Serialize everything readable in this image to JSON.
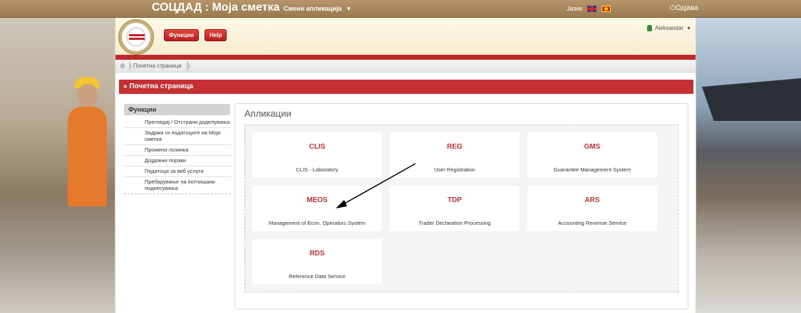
{
  "topbar": {
    "title": "СОЦДАД : Моја сметка",
    "switch_apps": "Смени апликација",
    "language": "Јазик",
    "logout": "Одјава"
  },
  "header": {
    "functions_btn": "Функции",
    "help_btn": "Help",
    "user": "Aleksandar"
  },
  "breadcrumb": {
    "home": "Почетна страница"
  },
  "page_title": "» Почетна страница",
  "sidebar": {
    "header": "Функции",
    "items": [
      {
        "label": "Прегледај / Отстрани доделувања"
      },
      {
        "label": "Задржи ги податоците на Моја сметка"
      },
      {
        "label": "Промени лозинка"
      },
      {
        "label": "Дојдовни пораки"
      },
      {
        "label": "Податоци за веб услуги"
      },
      {
        "label": "Пребарување на потпишани поднесувања"
      }
    ]
  },
  "apps": {
    "title": "Апликации",
    "tiles": [
      {
        "code": "CLIS",
        "name": "CLIS - Laboratory"
      },
      {
        "code": "REG",
        "name": "User Registration"
      },
      {
        "code": "GMS",
        "name": "Guarantee Management System"
      },
      {
        "code": "MEOS",
        "name": "Management of Econ. Operators System"
      },
      {
        "code": "TDP",
        "name": "Trader Declaration Processing"
      },
      {
        "code": "ARS",
        "name": "Accounting Revenue Service"
      },
      {
        "code": "RDS",
        "name": "Reference Data Service"
      }
    ]
  },
  "colors": {
    "accent": "#c62f34",
    "topbar": "#a8845a"
  }
}
